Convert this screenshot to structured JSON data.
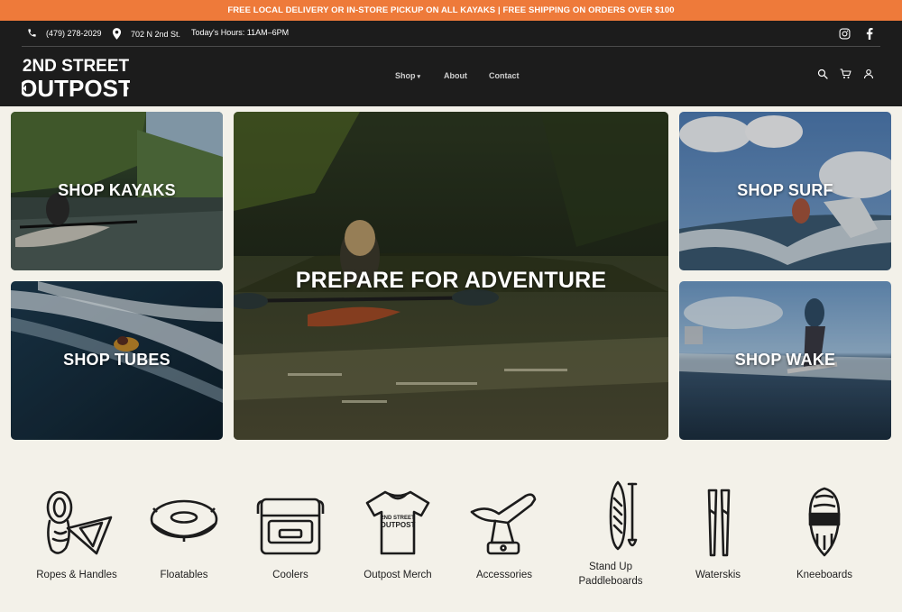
{
  "promo_bar": {
    "text": "FREE LOCAL DELIVERY OR IN-STORE PICKUP ON ALL KAYAKS | FREE SHIPPING ON ORDERS OVER $100"
  },
  "utility": {
    "phone": "(479) 278-2029",
    "address": "702 N 2nd St.",
    "hours": "Today's Hours: 11AM–6PM",
    "social": [
      "instagram-icon",
      "facebook-icon"
    ]
  },
  "logo": {
    "line1": "2ND STREET",
    "line2": "OUTPOST"
  },
  "nav": {
    "items": [
      "Shop",
      "About",
      "Contact"
    ],
    "shop_caret": "▾"
  },
  "header_icons": [
    "search-icon",
    "cart-icon",
    "account-icon"
  ],
  "hero_tiles": {
    "kayaks": "SHOP KAYAKS",
    "tubes": "SHOP TUBES",
    "main": "PREPARE FOR ADVENTURE",
    "surf": "SHOP SURF",
    "wake": "SHOP WAKE"
  },
  "categories": [
    {
      "label": "Ropes & Handles",
      "icon": "rope-handle-icon"
    },
    {
      "label": "Floatables",
      "icon": "tube-float-icon"
    },
    {
      "label": "Coolers",
      "icon": "cooler-icon"
    },
    {
      "label": "Outpost Merch",
      "icon": "tshirt-icon"
    },
    {
      "label": "Accessories",
      "icon": "rod-holder-icon"
    },
    {
      "label": "Stand Up Paddleboards",
      "icon": "paddleboard-icon"
    },
    {
      "label": "Waterskis",
      "icon": "waterskis-icon"
    },
    {
      "label": "Kneeboards",
      "icon": "kneeboard-icon"
    }
  ],
  "merch_shirt_text": {
    "line1": "2ND STREET",
    "line2": "OUTPOST"
  },
  "colors": {
    "promo": "#ee7a3a",
    "header": "#1c1c1c",
    "page_bg": "#f3f1e9"
  }
}
